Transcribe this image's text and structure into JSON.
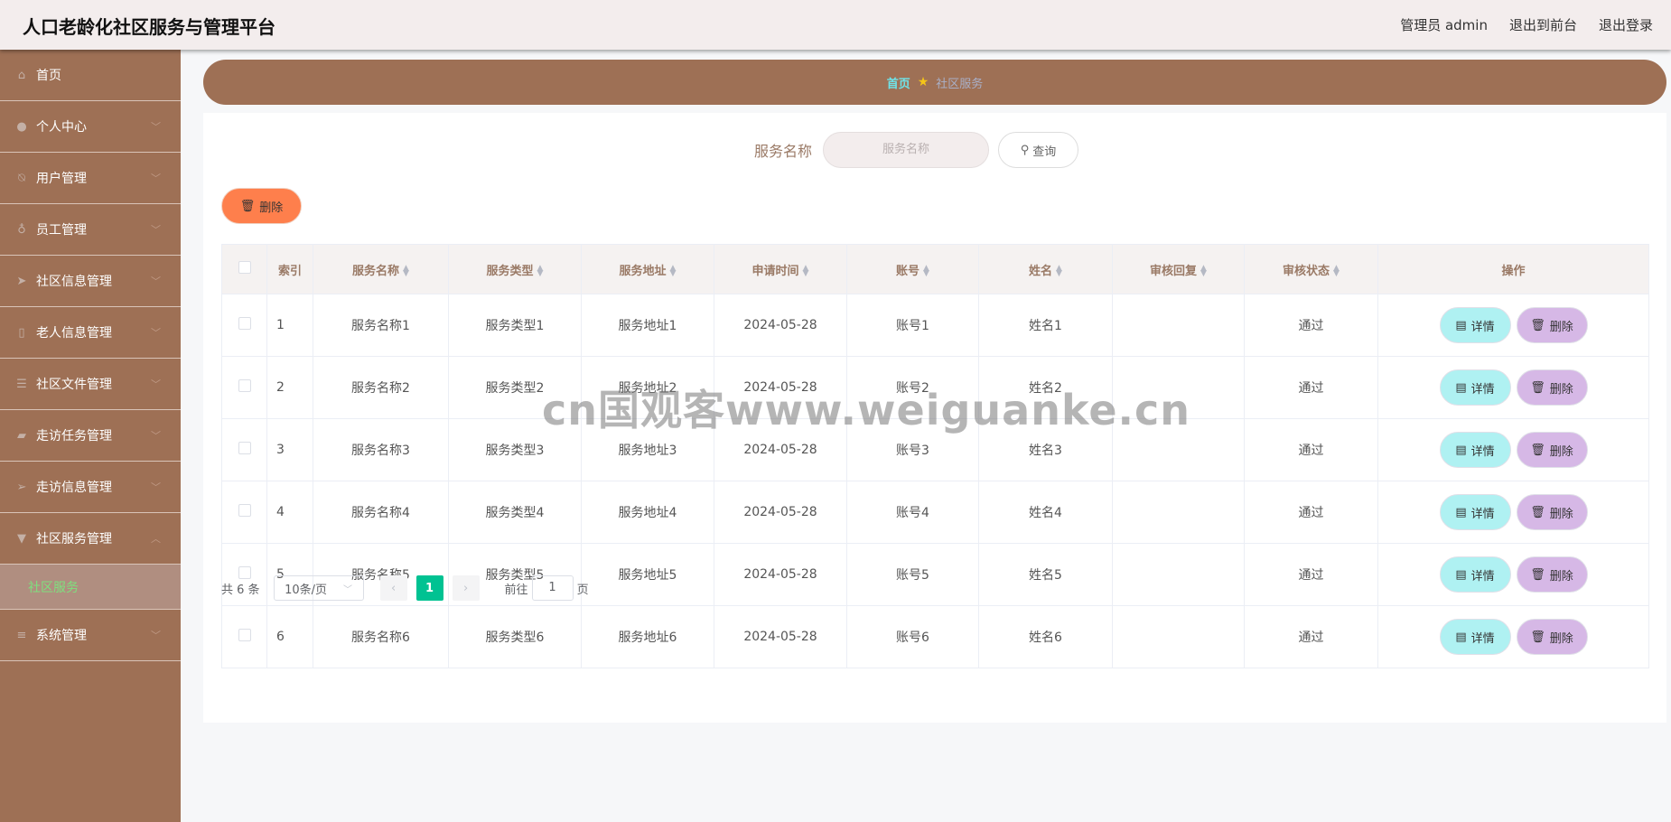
{
  "header": {
    "title": "人口老龄化社区服务与管理平台",
    "links": [
      "管理员 admin",
      "退出到前台",
      "退出登录"
    ]
  },
  "sidebar": {
    "items": [
      {
        "label": "首页",
        "icon": "home-icon"
      },
      {
        "label": "个人中心",
        "icon": "user-icon"
      },
      {
        "label": "用户管理",
        "icon": "bell-off-icon"
      },
      {
        "label": "员工管理",
        "icon": "microphone-icon"
      },
      {
        "label": "社区信息管理",
        "icon": "send-icon"
      },
      {
        "label": "老人信息管理",
        "icon": "phone-icon"
      },
      {
        "label": "社区文件管理",
        "icon": "sliders-icon"
      },
      {
        "label": "走访任务管理",
        "icon": "wallet-icon"
      },
      {
        "label": "走访信息管理",
        "icon": "navigation-icon"
      },
      {
        "label": "社区服务管理",
        "icon": "brush-icon"
      },
      {
        "label": "系统管理",
        "icon": "menu-icon"
      }
    ],
    "active_sub": "社区服务"
  },
  "breadcrumb": {
    "home": "首页",
    "current": "社区服务"
  },
  "search": {
    "label": "服务名称",
    "placeholder": "服务名称",
    "button": "查询"
  },
  "toolbar": {
    "delete": "删除"
  },
  "table": {
    "headers": [
      "索引",
      "服务名称",
      "服务类型",
      "服务地址",
      "申请时间",
      "账号",
      "姓名",
      "审核回复",
      "审核状态",
      "操作"
    ],
    "rows": [
      [
        "1",
        "服务名称1",
        "服务类型1",
        "服务地址1",
        "2024-05-28",
        "账号1",
        "姓名1",
        "",
        "通过"
      ],
      [
        "2",
        "服务名称2",
        "服务类型2",
        "服务地址2",
        "2024-05-28",
        "账号2",
        "姓名2",
        "",
        "通过"
      ],
      [
        "3",
        "服务名称3",
        "服务类型3",
        "服务地址3",
        "2024-05-28",
        "账号3",
        "姓名3",
        "",
        "通过"
      ],
      [
        "4",
        "服务名称4",
        "服务类型4",
        "服务地址4",
        "2024-05-28",
        "账号4",
        "姓名4",
        "",
        "通过"
      ],
      [
        "5",
        "服务名称5",
        "服务类型5",
        "服务地址5",
        "2024-05-28",
        "账号5",
        "姓名5",
        "",
        "通过"
      ],
      [
        "6",
        "服务名称6",
        "服务类型6",
        "服务地址6",
        "2024-05-28",
        "账号6",
        "姓名6",
        "",
        "通过"
      ]
    ],
    "detail_label": "详情",
    "delete_label": "删除"
  },
  "pagination": {
    "total": "共 6 条",
    "page_size": "10条/页",
    "current": "1",
    "goto_prefix": "前往",
    "goto_value": "1",
    "goto_suffix": "页"
  },
  "watermark": "cn国观客www.weiguanke.cn",
  "colors": {
    "sidebar": "#9e7055",
    "accent_green": "#00c292",
    "delete_orange": "#fe7f4c",
    "detail_cyan": "#aff1f2",
    "delete_purple": "#d6b8e6"
  }
}
